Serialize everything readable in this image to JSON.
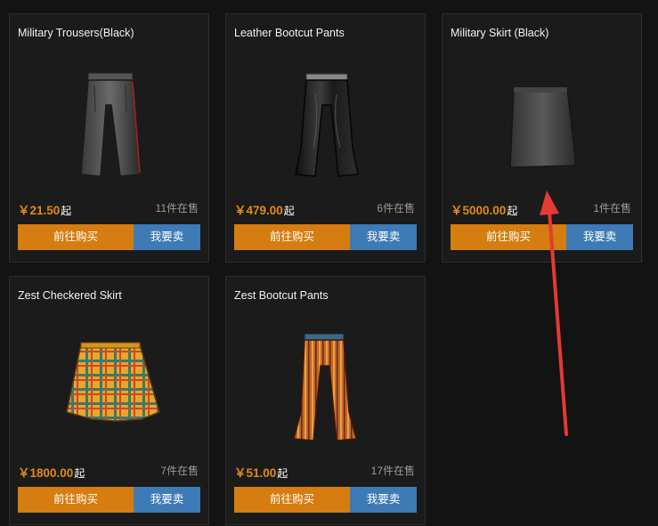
{
  "currency_symbol": "￥",
  "price_suffix": "起",
  "buy_label": "前往购买",
  "sell_label": "我要卖",
  "colors": {
    "price": "#e08a15",
    "buy_button": "#d57d10",
    "sell_button": "#3d7ab6",
    "annotation_arrow": "#e53935"
  },
  "items": [
    {
      "title": "Military Trousers(Black)",
      "price": "21.50",
      "stock": "11件在售",
      "icon": "black-military-trousers-image"
    },
    {
      "title": "Leather Bootcut Pants",
      "price": "479.00",
      "stock": "6件在售",
      "icon": "leather-bootcut-pants-image"
    },
    {
      "title": "Military Skirt (Black)",
      "price": "5000.00",
      "stock": "1件在售",
      "icon": "black-military-skirt-image"
    },
    {
      "title": "Zest Checkered Skirt",
      "price": "1800.00",
      "stock": "7件在售",
      "icon": "zest-checkered-skirt-image"
    },
    {
      "title": "Zest Bootcut Pants",
      "price": "51.00",
      "stock": "17件在售",
      "icon": "zest-bootcut-pants-image"
    }
  ]
}
